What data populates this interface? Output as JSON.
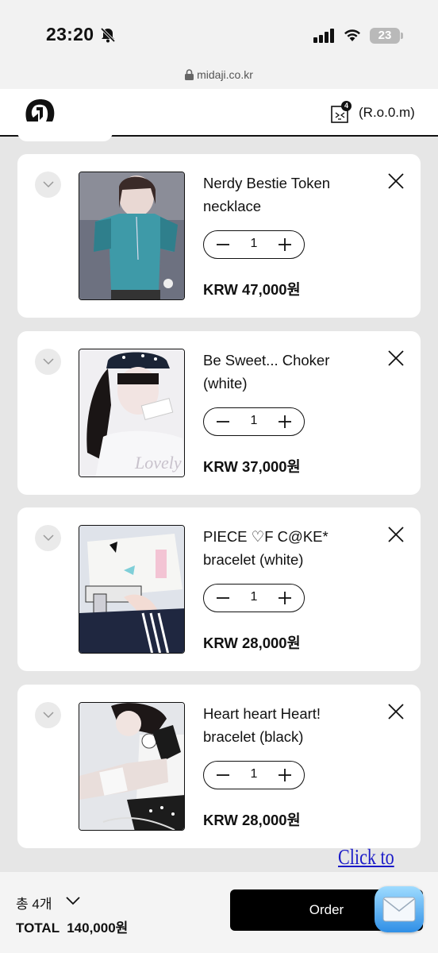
{
  "status_bar": {
    "time": "23:20",
    "battery": "23"
  },
  "browser": {
    "url": "midaji.co.kr"
  },
  "header": {
    "cart_count": "4",
    "room_label": "(R.o.0.m)"
  },
  "items": [
    {
      "name": "Nerdy Bestie Token necklace",
      "quantity": "1",
      "price": "KRW 47,000원"
    },
    {
      "name": "Be Sweet... Choker (white)",
      "quantity": "1",
      "price": "KRW 37,000원"
    },
    {
      "name": "PIECE ♡F C@KE* bracelet (white)",
      "quantity": "1",
      "price": "KRW 28,000원"
    },
    {
      "name": "Heart heart Heart! bracelet (black)",
      "quantity": "1",
      "price": "KRW 28,000원"
    }
  ],
  "scroll_top": {
    "label": "Click to top"
  },
  "footer": {
    "count_label": "총 4개",
    "total_label": "TOTAL  140,000원",
    "order_label": "Order"
  },
  "colors": {
    "link": "#1a1ac8",
    "button": "#000000",
    "card": "#ffffff"
  }
}
